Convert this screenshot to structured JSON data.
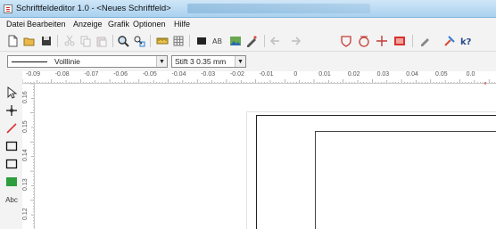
{
  "window": {
    "title": "Schriftfeldeditor 1.0 - <Neues Schriftfeld>"
  },
  "menu": [
    "Datei",
    "Bearbeiten",
    "Anzeige",
    "Grafik",
    "Optionen",
    "Hilfe"
  ],
  "propbar": {
    "line_style": "Volllinie",
    "line_width": "Stift 3  0.35 mm"
  },
  "ruler": {
    "h_labels": [
      "-0.09",
      "-0.08",
      "-0.07",
      "-0.06",
      "-0.05",
      "-0.04",
      "-0.03",
      "-0.02",
      "-0.01",
      "0",
      "0.01",
      "0.02",
      "0.03",
      "0.04",
      "0.05",
      "0.0"
    ],
    "v_labels": [
      "0.16",
      "0.15",
      "0.14",
      "0.13",
      "0.12"
    ]
  },
  "toolbox": {
    "text_tool": "Abc"
  },
  "colors": {
    "titlebar": "#a9d1ef",
    "chrome": "#f3f3f3",
    "accent_red": "#d9322e",
    "fill_green": "#2e9d3c"
  }
}
